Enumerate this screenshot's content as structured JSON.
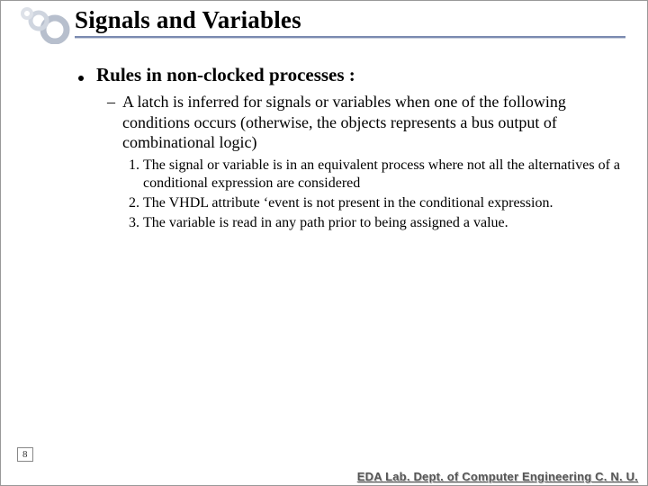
{
  "slide": {
    "title": "Signals and Variables",
    "bullet": "Rules in non-clocked processes :",
    "dash": "A latch is inferred for signals or variables when one of the following conditions occurs (otherwise, the objects represents a bus output of combinational logic)",
    "numbered": [
      "The signal or variable is in an equivalent process  where not all the alternatives of a conditional expression are considered",
      "The VHDL attribute ‘event is not present in the conditional expression.",
      "The variable is read in any path prior to being assigned a value."
    ],
    "page_number": "8",
    "footer": "EDA Lab. Dept. of Computer Engineering C. N. U."
  },
  "icons": {
    "logo": "slide-logo"
  }
}
